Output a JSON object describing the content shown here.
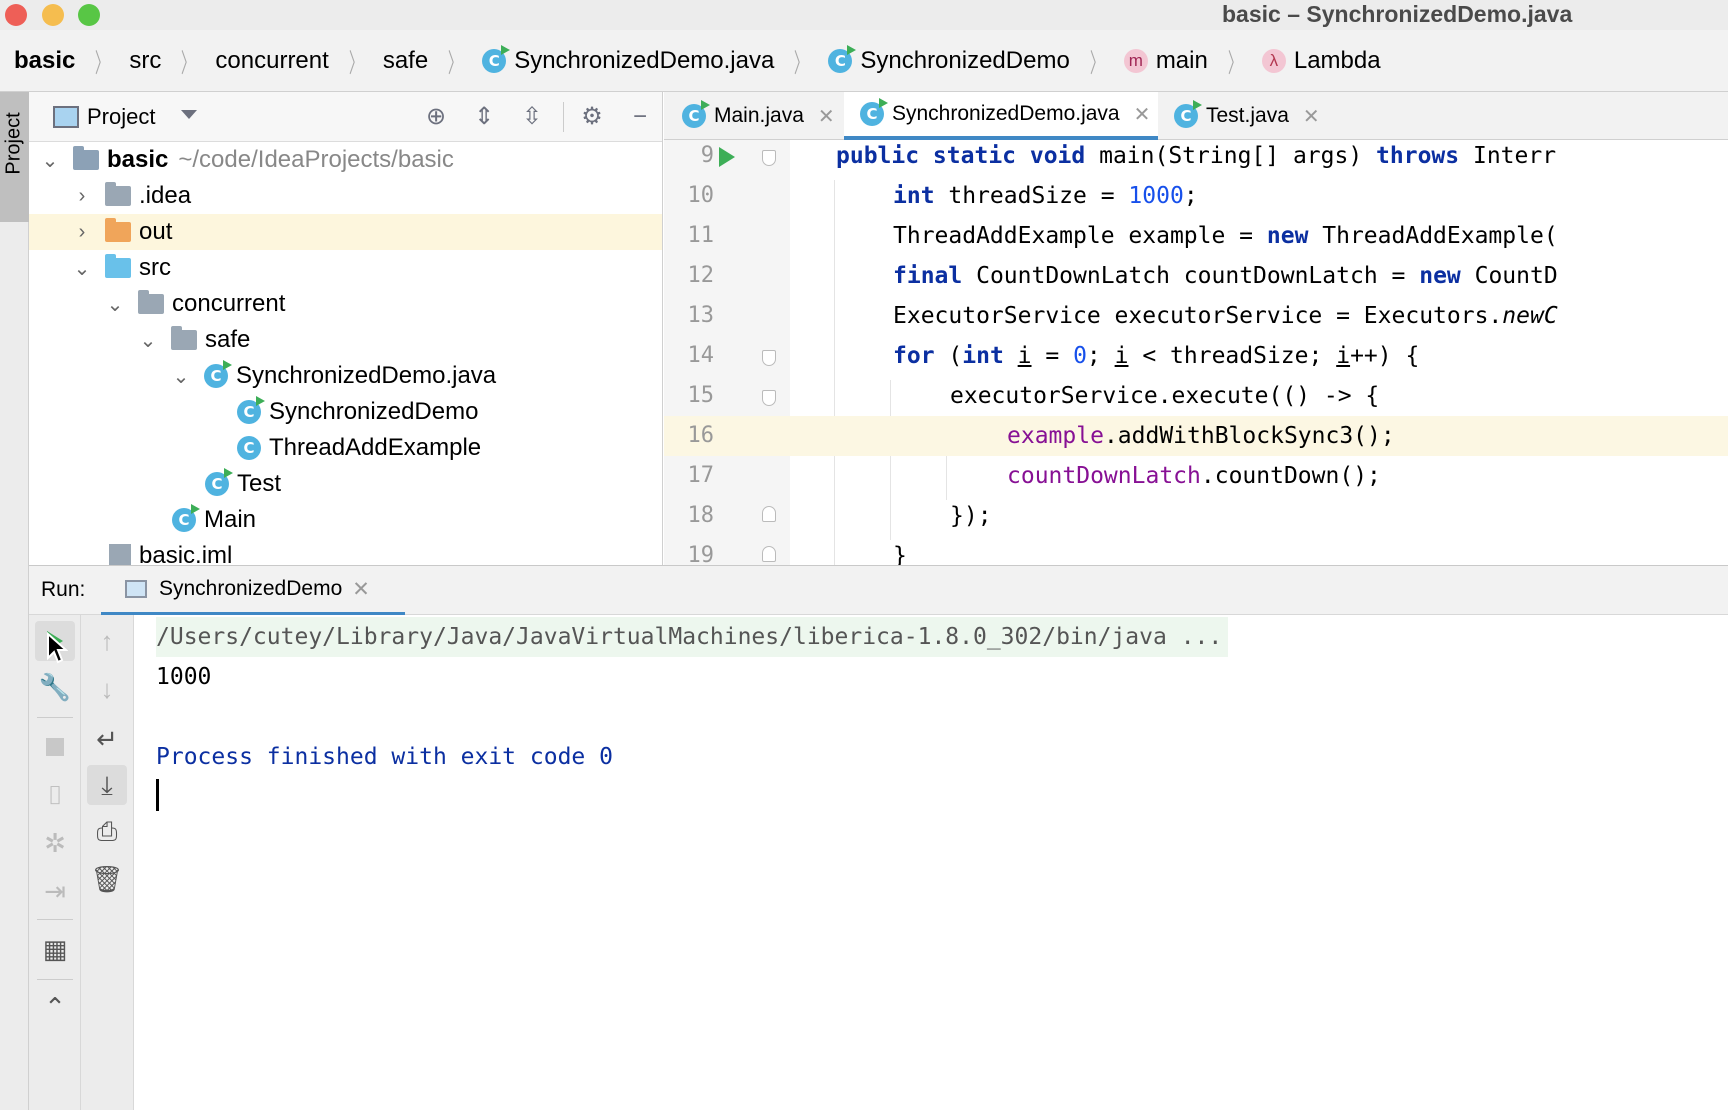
{
  "window": {
    "title": "basic – SynchronizedDemo.java"
  },
  "breadcrumb": [
    "basic",
    "src",
    "concurrent",
    "safe",
    "SynchronizedDemo.java",
    "SynchronizedDemo",
    "main",
    "Lambda"
  ],
  "sidebar": {
    "project_tab": "Project"
  },
  "project": {
    "header": "Project",
    "tree": [
      {
        "label": "basic",
        "suffix": "~/code/IdeaProjects/basic"
      },
      {
        "label": ".idea"
      },
      {
        "label": "out"
      },
      {
        "label": "src"
      },
      {
        "label": "concurrent"
      },
      {
        "label": "safe"
      },
      {
        "label": "SynchronizedDemo.java"
      },
      {
        "label": "SynchronizedDemo"
      },
      {
        "label": "ThreadAddExample"
      },
      {
        "label": "Test"
      },
      {
        "label": "Main"
      },
      {
        "label": "basic.iml"
      }
    ]
  },
  "editor": {
    "tabs": [
      "Main.java",
      "SynchronizedDemo.java",
      "Test.java"
    ],
    "line_numbers": [
      "9",
      "10",
      "11",
      "12",
      "13",
      "14",
      "15",
      "16",
      "17",
      "18",
      "19"
    ],
    "code": {
      "l9_kw1": "public static void",
      "l9_mid": " main(String[] args) ",
      "l9_kw2": "throws",
      "l9_end": " Interr",
      "l10_kw": "int",
      "l10_mid": " threadSize = ",
      "l10_num": "1000",
      "l10_end": ";",
      "l11_a": "ThreadAddExample example = ",
      "l11_kw": "new",
      "l11_b": " ThreadAddExample(",
      "l12_kw": "final",
      "l12_a": " CountDownLatch countDownLatch = ",
      "l12_kw2": "new",
      "l12_b": " CountD",
      "l13_a": "ExecutorService executorService = Executors.",
      "l13_it": "newC",
      "l14_kw": "for",
      "l14_a": " (",
      "l14_kw2": "int",
      "l14_sp": " ",
      "l14_i1": "i",
      "l14_b": " = ",
      "l14_num": "0",
      "l14_c": "; ",
      "l14_i2": "i",
      "l14_d": " < threadSize; ",
      "l14_i3": "i",
      "l14_e": "++) {",
      "l15": "executorService.execute(() -> {",
      "l16_f": "example",
      "l16_a": ".addWithBlockSync3();",
      "l17_f": "countDownLatch",
      "l17_a": ".countDown();",
      "l18": "});",
      "l19": "}"
    }
  },
  "run": {
    "label": "Run:",
    "tab": "SynchronizedDemo",
    "console": [
      "/Users/cutey/Library/Java/JavaVirtualMachines/liberica-1.8.0_302/bin/java ...",
      "1000",
      "",
      "Process finished with exit code 0"
    ]
  }
}
